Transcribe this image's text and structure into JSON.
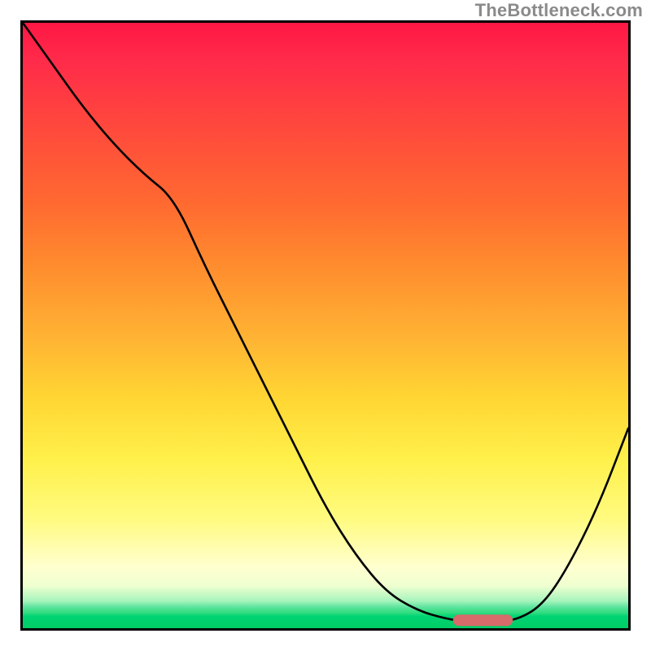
{
  "attribution": "TheBottleneck.com",
  "colors": {
    "marker": "#d76a6a",
    "curve": "#000000"
  },
  "chart_data": {
    "type": "line",
    "title": "",
    "xlabel": "",
    "ylabel": "",
    "xlim": [
      0,
      100
    ],
    "ylim": [
      0,
      100
    ],
    "grid": false,
    "legend": false,
    "background": "heatmap-gradient red→yellow→green (top→bottom)",
    "series": [
      {
        "name": "bottleneck-curve",
        "x": [
          0,
          5,
          10,
          15,
          20,
          25,
          30,
          35,
          40,
          45,
          50,
          55,
          60,
          65,
          70,
          74,
          78,
          82,
          86,
          90,
          95,
          100
        ],
        "y": [
          100,
          93,
          86,
          80,
          75,
          71,
          60,
          50,
          40,
          30,
          20,
          12,
          6,
          3,
          1.5,
          1,
          1,
          1.5,
          4,
          10,
          20,
          33
        ]
      }
    ],
    "annotations": [
      {
        "name": "optimal-range-marker",
        "x_start": 72,
        "x_end": 80,
        "y": 1.3,
        "color": "#d76a6a"
      }
    ]
  }
}
